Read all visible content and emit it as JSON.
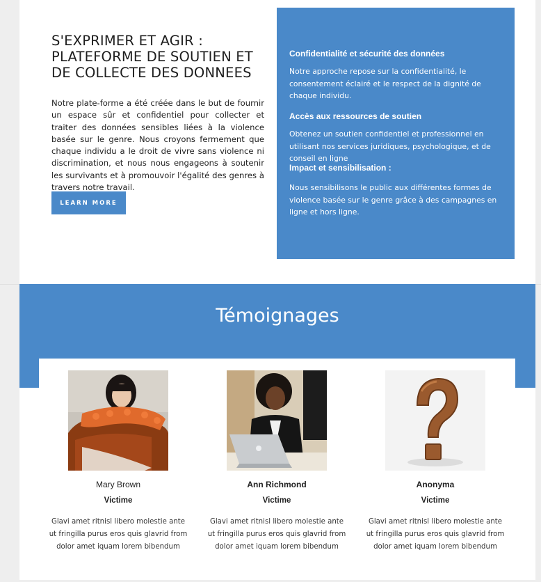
{
  "intro": {
    "title": "S'EXPRIMER ET AGIR : PLATEFORME DE SOUTIEN ET DE COLLECTE DES DONNEES",
    "text": "Notre plate-forme a été créée dans le but de fournir un espace sûr et confidentiel pour collecter et traiter des données sensibles liées à la violence basée sur le genre. Nous croyons fermement que chaque individu a le droit de vivre sans violence ni discrimination, et nous nous engageons à soutenir les survivants et à promouvoir l'égalité des genres à travers notre travail.",
    "button_label": "LEARN MORE"
  },
  "features": [
    {
      "title": "Confidentialité et sécurité des données",
      "text": "Notre approche repose sur la confidentialité, le consentement éclairé et le respect de la dignité de chaque individu."
    },
    {
      "title": "Accès aux ressources de soutien",
      "text": "Obtenez un soutien confidentiel et professionnel en utilisant nos services juridiques, psychologique, et de conseil en ligne"
    },
    {
      "title": "Impact et sensibilisation :",
      "text": "Nous sensibilisons le public aux différentes formes de violence basée sur le genre grâce à des campagnes en ligne et hors ligne."
    }
  ],
  "testimonials": {
    "title": "Témoignages",
    "people": [
      {
        "name": "Mary Brown",
        "role": "Victime",
        "quote": "Glavi amet ritnisl libero molestie ante ut fringilla purus eros quis glavrid from dolor amet iquam lorem bibendum"
      },
      {
        "name": "Ann Richmond",
        "role": "Victime",
        "quote": "Glavi amet ritnisl libero molestie ante ut fringilla purus eros quis glavrid from dolor amet iquam lorem bibendum"
      },
      {
        "name": "Anonyma",
        "role": "Victime",
        "quote": "Glavi amet ritnisl libero molestie ante ut fringilla purus eros quis glavrid from dolor amet iquam lorem bibendum"
      }
    ]
  },
  "colors": {
    "accent_blue": "#4a89c9",
    "text_dark": "#222222",
    "background": "#eeeeee"
  }
}
